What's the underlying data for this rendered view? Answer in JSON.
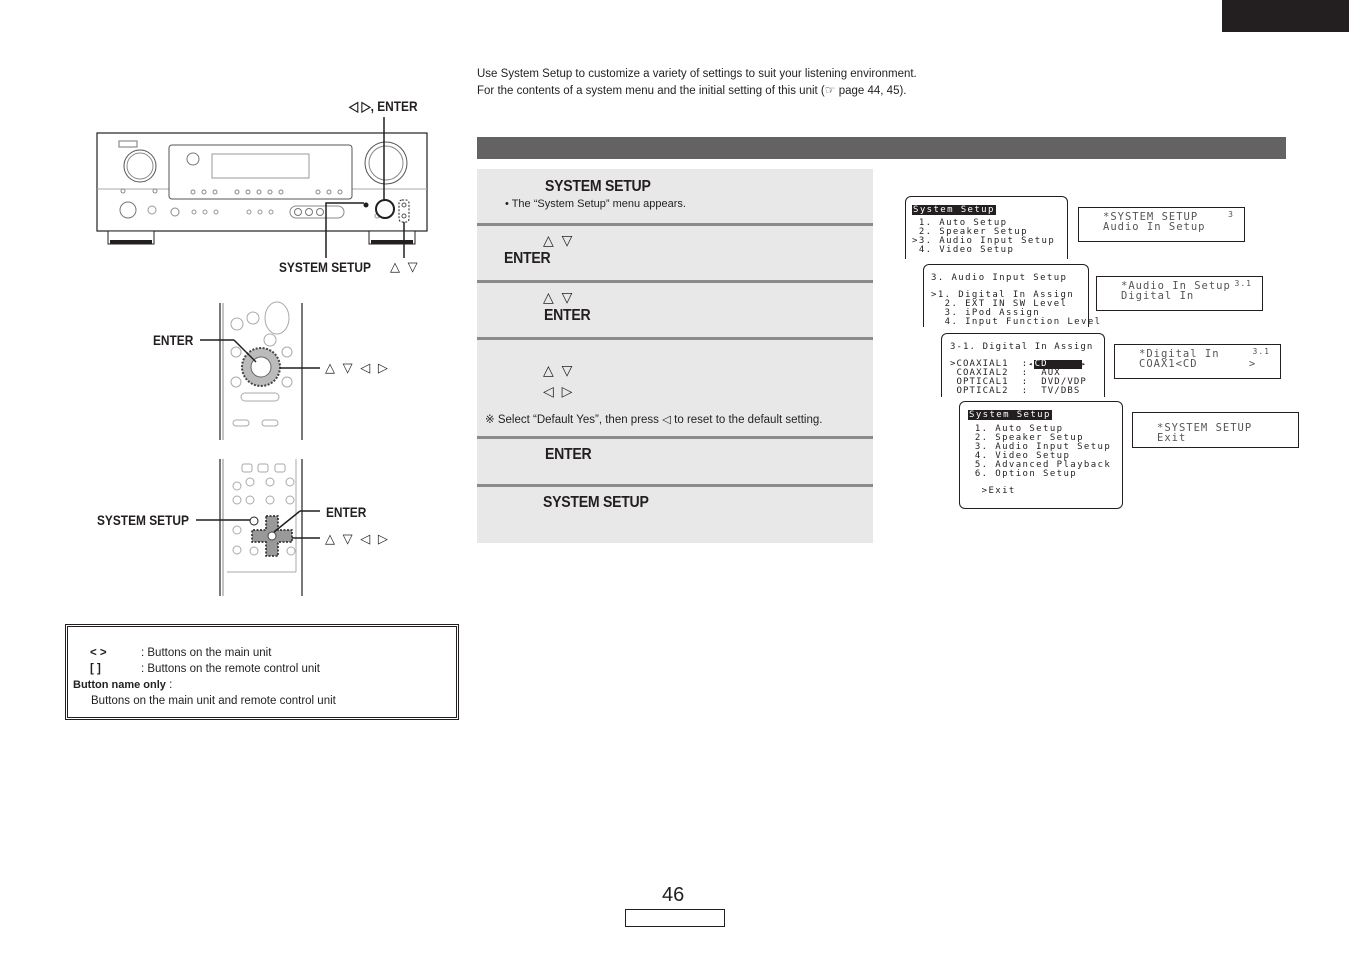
{
  "intro": {
    "line1": "Use System Setup to customize a variety of settings to suit your listening environment.",
    "line2_prefix": "For the contents of a system menu and the initial setting of this unit (",
    "line2_icon": "pointing-hand-icon",
    "line2_suffix": " page 44, 45)."
  },
  "main_unit": {
    "label_top": "◁ ▷, ENTER",
    "label_system_setup": "SYSTEM SETUP",
    "label_updown": "△ ▽"
  },
  "remote_top": {
    "label_enter": "ENTER",
    "label_arrows": "△ ▽ ◁ ▷"
  },
  "remote_bottom": {
    "label_system_setup": "SYSTEM SETUP",
    "label_enter": "ENTER",
    "label_arrows": "△ ▽ ◁ ▷"
  },
  "legend": {
    "row1_symbol": "<    >",
    "row1_text": ": Buttons on the main unit",
    "row2_symbol": "[     ]",
    "row2_text": ": Buttons on the remote control unit",
    "row3_bold": "Button name only",
    "row3_colon": " :",
    "row4_text": "Buttons on the main unit and remote control unit"
  },
  "steps": [
    {
      "key": "SYSTEM SETUP",
      "note": "• The “System Setup” menu appears."
    },
    {
      "arrows": "△ ▽",
      "key": "ENTER"
    },
    {
      "arrows": "△ ▽",
      "key": "ENTER"
    },
    {
      "arrows": "△ ▽",
      "arrows2": "◁ ▷",
      "note": "※ Select “Default Yes”, then press ◁ to reset to the default setting."
    },
    {
      "key": "ENTER"
    },
    {
      "key": "SYSTEM SETUP"
    }
  ],
  "osd": {
    "screen1": {
      "title": "System Setup",
      "items": [
        " 1. Auto Setup",
        " 2. Speaker Setup",
        ">3. Audio Input Setup",
        " 4. Video Setup"
      ]
    },
    "fl1": {
      "line1": "*SYSTEM SETUP",
      "line2": "Audio In Setup",
      "corner": "3"
    },
    "screen2": {
      "title": "3. Audio Input Setup",
      "items": [
        ">1. Digital In Assign",
        "  2. EXT IN SW Level",
        "  3. iPod Assign",
        "  4. Input Function Level"
      ]
    },
    "fl2": {
      "line1": "*Audio In Setup",
      "line2": "Digital In",
      "corner": "3.1"
    },
    "screen3": {
      "title": "3-1. Digital In Assign",
      "rows": [
        {
          "prefix": ">COAXIAL1  :",
          "value": "CD",
          "selected": true
        },
        {
          "prefix": " COAXIAL2  :  ",
          "value": "AUX"
        },
        {
          "prefix": " OPTICAL1  :  ",
          "value": "DVD/VDP"
        },
        {
          "prefix": " OPTICAL2  :  ",
          "value": "TV/DBS"
        }
      ]
    },
    "fl3": {
      "line1": "*Digital In",
      "line2": "COAX1<CD       >",
      "corner": "3.1"
    },
    "screen4": {
      "title": "System Setup",
      "items": [
        " 1. Auto Setup",
        " 2. Speaker Setup",
        " 3. Audio Input Setup",
        " 4. Video Setup",
        " 5. Advanced Playback",
        " 6. Option Setup",
        "",
        "  >Exit"
      ]
    },
    "fl4": {
      "line1": "*SYSTEM SETUP",
      "line2": "Exit"
    }
  },
  "page": {
    "number": "46"
  }
}
